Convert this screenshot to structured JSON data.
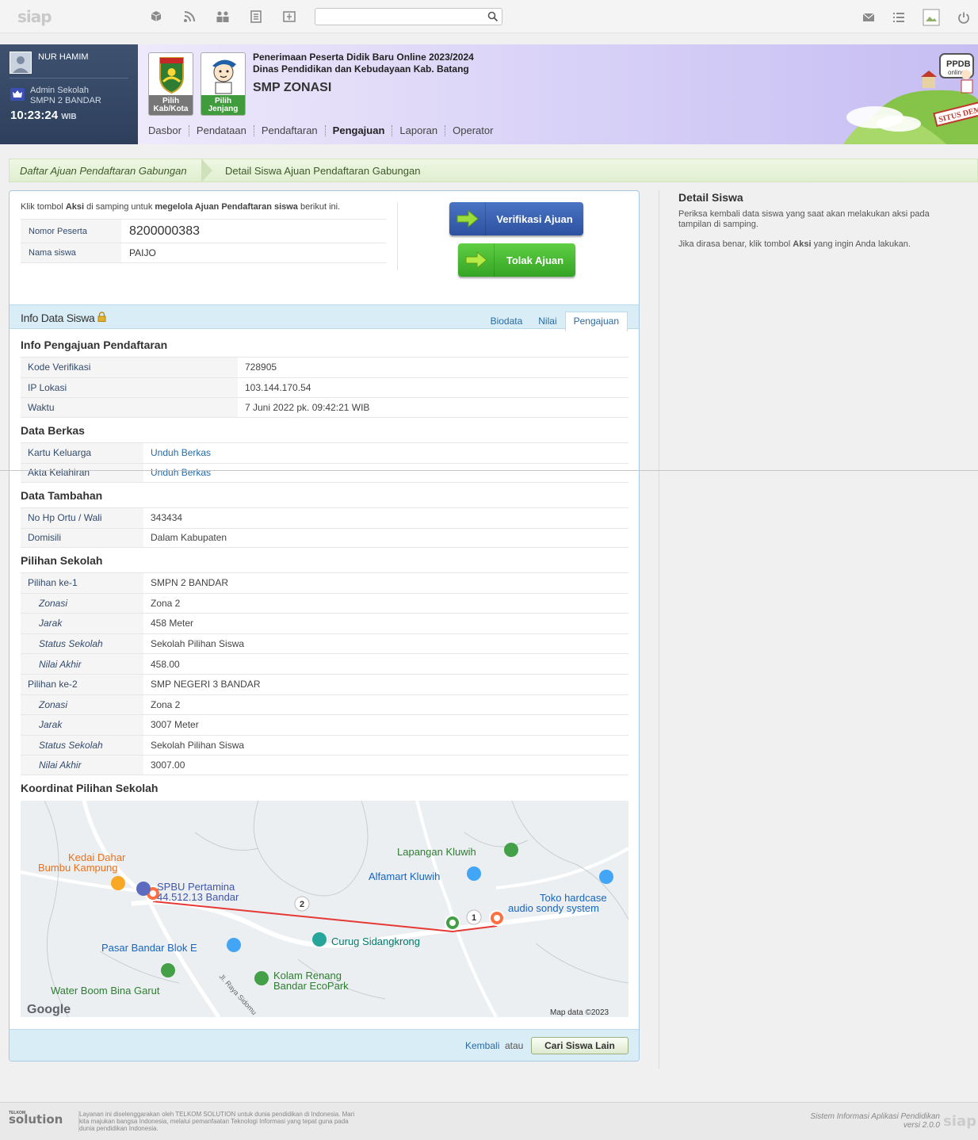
{
  "topbar": {
    "logo": "siap",
    "search_value": "",
    "search_placeholder": ""
  },
  "user": {
    "name": "NUR HAMIM",
    "role": "Admin Sekolah",
    "school": "SMPN 2 BANDAR",
    "time": "10:23:24",
    "timezone": "WIB"
  },
  "banner": {
    "pick1": "Pilih Kab/Kota",
    "pick2": "Pilih Jenjang",
    "title_line1": "Penerimaan Peserta Didik Baru Online 2023/2024",
    "title_line2": "Dinas Pendidikan dan Kebudayaan Kab. Batang",
    "subtitle": "SMP ZONASI",
    "ppdb_label": "PPDB",
    "online_label": "online",
    "demo_label": "SITUS DEMO"
  },
  "nav": [
    "Dasbor",
    "Pendataan",
    "Pendaftaran",
    "Pengajuan",
    "Laporan",
    "Operator"
  ],
  "breadcrumb": {
    "parent": "Daftar Ajuan Pendaftaran Gabungan",
    "current": "Detail Siswa Ajuan Pendaftaran Gabungan"
  },
  "summary": {
    "hint_prefix": "Klik tombol ",
    "hint_b1": "Aksi",
    "hint_mid": " di samping untuk ",
    "hint_b2": "megelola Ajuan Pendaftaran siswa",
    "hint_suffix": " berikut ini.",
    "nomor_label": "Nomor Peserta",
    "nomor_value": "8200000383",
    "nama_label": "Nama siswa",
    "nama_value": "PAIJO"
  },
  "actions": {
    "verify": "Verifikasi Ajuan",
    "reject": "Tolak Ajuan"
  },
  "info": {
    "title": "Info Data Siswa",
    "tabs": [
      "Biodata",
      "Nilai",
      "Pengajuan"
    ]
  },
  "pengajuan": {
    "title": "Info Pengajuan Pendaftaran",
    "rows": [
      {
        "k": "Kode Verifikasi",
        "v": "728905"
      },
      {
        "k": "IP Lokasi",
        "v": "103.144.170.54"
      },
      {
        "k": "Waktu",
        "v": "7 Juni 2022 pk. 09:42:21 WIB"
      }
    ]
  },
  "berkas": {
    "title": "Data Berkas",
    "rows": [
      {
        "k": "Kartu Keluarga",
        "v": "Unduh Berkas"
      },
      {
        "k": "Akta Kelahiran",
        "v": "Unduh Berkas"
      }
    ]
  },
  "tambahan": {
    "title": "Data Tambahan",
    "rows": [
      {
        "k": "No Hp Ortu / Wali",
        "v": "343434"
      },
      {
        "k": "Domisili",
        "v": "Dalam Kabupaten"
      }
    ]
  },
  "pilihan": {
    "title": "Pilihan Sekolah",
    "rows": [
      {
        "k": "Pilihan ke-1",
        "v": "SMPN 2 BANDAR"
      },
      {
        "k": "Zonasi",
        "v": "Zona 2"
      },
      {
        "k": "Jarak",
        "v": "458 Meter"
      },
      {
        "k": "Status Sekolah",
        "v": "Sekolah Pilihan Siswa"
      },
      {
        "k": "Nilai Akhir",
        "v": "458.00"
      },
      {
        "k": "Pilihan ke-2",
        "v": "SMP NEGERI 3 BANDAR"
      },
      {
        "k": "Zonasi",
        "v": "Zona 2"
      },
      {
        "k": "Jarak",
        "v": "3007 Meter"
      },
      {
        "k": "Status Sekolah",
        "v": "Sekolah Pilihan Siswa"
      },
      {
        "k": "Nilai Akhir",
        "v": "3007.00"
      }
    ]
  },
  "map": {
    "title": "Koordinat Pilihan Sekolah",
    "labels": {
      "kedai1": "Kedai Dahar",
      "kedai2": "Bumbu Kampung",
      "spbu1": "SPBU Pertamina",
      "spbu2": "44.512.13 Bandar",
      "lapangan": "Lapangan Kluwih",
      "alfamart": "Alfamart Kluwih",
      "toko1": "Toko hardcase",
      "toko2": "audio sondy system",
      "pasar": "Pasar Bandar Blok E",
      "curug": "Curug Sidangkrong",
      "kolam1": "Kolam Renang",
      "kolam2": "Bandar EcoPark",
      "water": "Water Boom Bina Garut",
      "road": "Jl. Raya Sidomu",
      "google": "Google",
      "copyright": "Map data ©2023",
      "marker1": "1",
      "marker2": "2"
    }
  },
  "cardfoot": {
    "back": "Kembali",
    "or": "atau",
    "other": "Cari Siswa Lain"
  },
  "right": {
    "title": "Detail Siswa",
    "p1": "Periksa kembali data siswa yang saat akan melakukan aksi pada tampilan di samping.",
    "p2_prefix": "Jika dirasa benar, klik tombol ",
    "p2_bold": "Aksi",
    "p2_suffix": " yang ingin Anda lakukan."
  },
  "footer": {
    "brand_small": "TELKOM",
    "brand": "solution",
    "text": "Layanan ini diselenggarakan oleh TELKOM SOLUTION untuk dunia pendidikan di Indonesia. Mari kita majukan bangsa Indonesia, melalui pemanfaatan Teknologi Informasi yang tepat guna pada dunia pendidikan Indonesia.",
    "right1": "Sistem Informasi Aplikasi Pendidikan",
    "right2": "versi 2.0.0",
    "logo": "siap"
  },
  "colors": {
    "accent": "#2b6aa3",
    "verify": "#2c51a0",
    "reject": "#34a424",
    "route": "#e53935"
  }
}
